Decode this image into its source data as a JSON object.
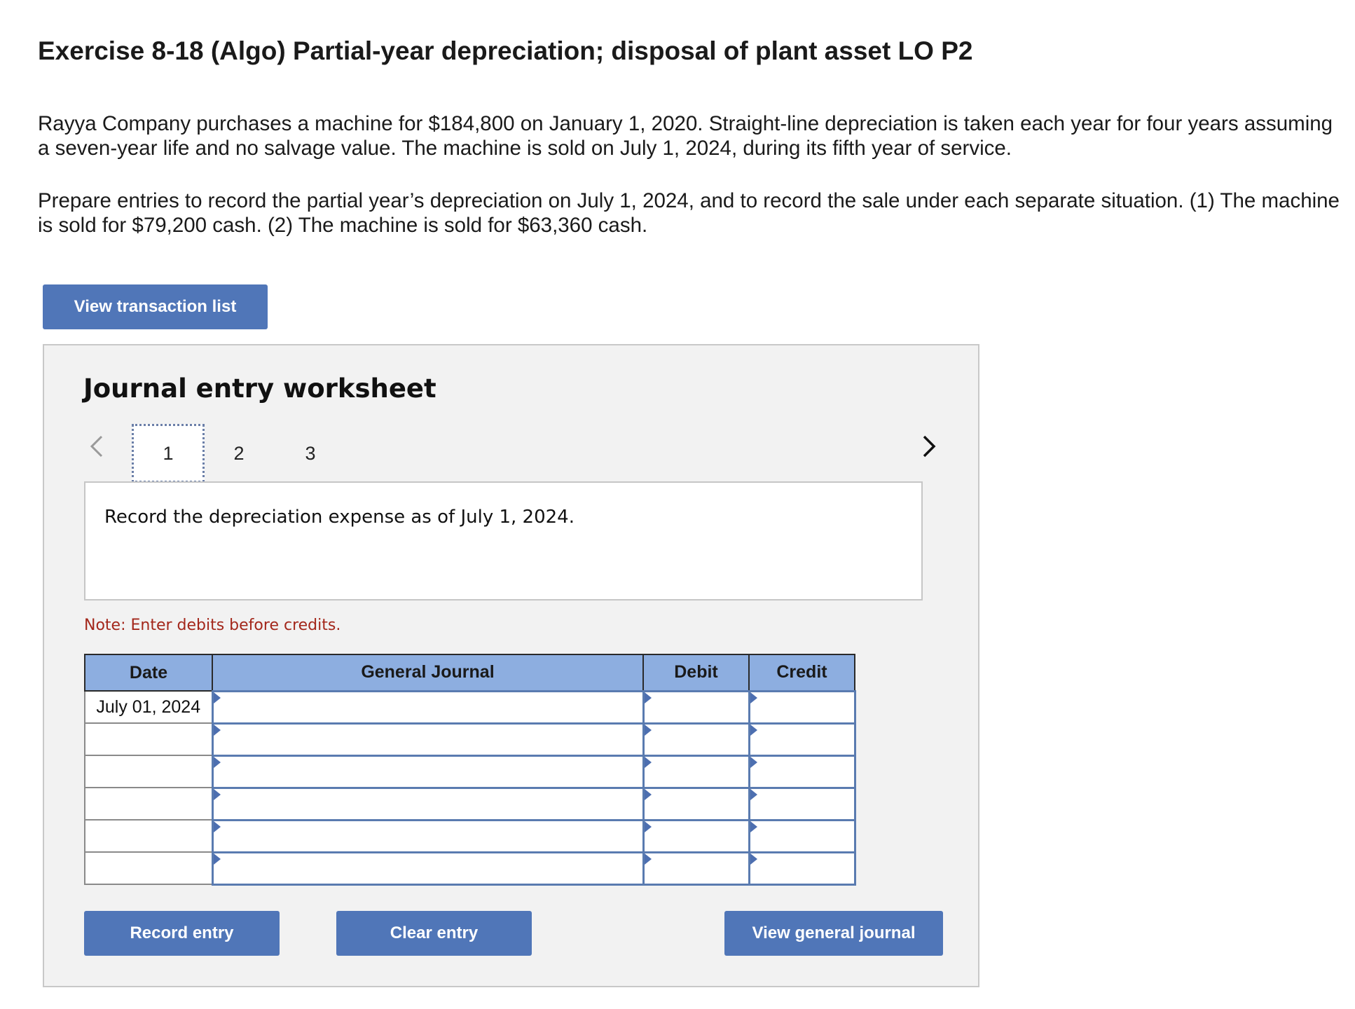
{
  "title": "Exercise 8-18 (Algo) Partial-year depreciation; disposal of plant asset LO P2",
  "paragraphs": [
    "Rayya Company purchases a machine for $184,800 on January 1, 2020. Straight-line depreciation is taken each year for four years assuming a seven-year life and no salvage value. The machine is sold on July 1, 2024, during its fifth year of service.",
    "Prepare entries to record the partial year’s depreciation on July 1, 2024, and to record the sale under each separate situation. (1) The machine is sold for $79,200 cash. (2) The machine is sold for $63,360 cash."
  ],
  "view_transaction_list_label": "View transaction list",
  "worksheet": {
    "title": "Journal entry worksheet",
    "prev_icon": "chevron-left-icon",
    "next_icon": "chevron-right-icon",
    "tabs": [
      {
        "label": "1",
        "active": true
      },
      {
        "label": "2",
        "active": false
      },
      {
        "label": "3",
        "active": false
      }
    ],
    "prompt": "Record the depreciation expense as of July 1, 2024.",
    "note": "Note: Enter debits before credits.",
    "columns": [
      "Date",
      "General Journal",
      "Debit",
      "Credit"
    ],
    "rows": [
      {
        "date": "July 01, 2024",
        "account": "",
        "debit": "",
        "credit": ""
      },
      {
        "date": "",
        "account": "",
        "debit": "",
        "credit": ""
      },
      {
        "date": "",
        "account": "",
        "debit": "",
        "credit": ""
      },
      {
        "date": "",
        "account": "",
        "debit": "",
        "credit": ""
      },
      {
        "date": "",
        "account": "",
        "debit": "",
        "credit": ""
      },
      {
        "date": "",
        "account": "",
        "debit": "",
        "credit": ""
      }
    ],
    "buttons": {
      "record": "Record entry",
      "clear": "Clear entry",
      "view_general_journal": "View general journal"
    }
  },
  "colors": {
    "button_bg": "#5076b8",
    "header_bg": "#8daee0",
    "note_text": "#a3271b",
    "panel_bg": "#f2f2f2"
  }
}
